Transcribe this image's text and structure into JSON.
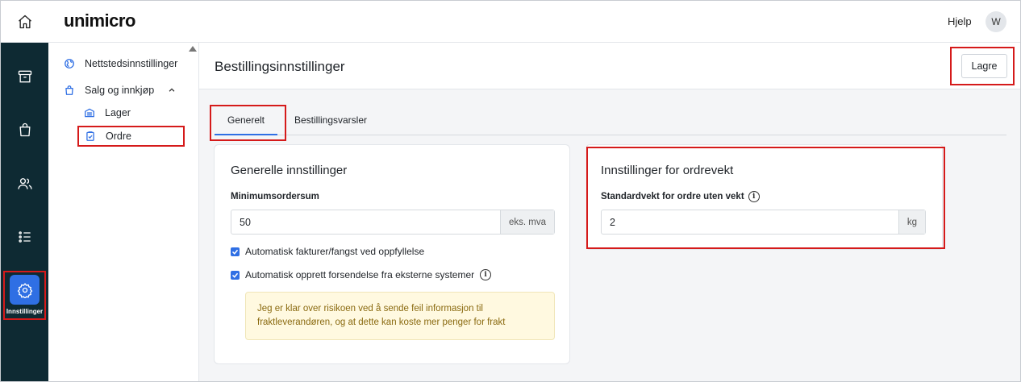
{
  "topbar": {
    "brand": "unimicro",
    "help_label": "Hjelp",
    "avatar_initial": "W"
  },
  "rail": {
    "items": [
      {
        "icon": "home-icon"
      },
      {
        "icon": "archive-icon"
      },
      {
        "icon": "shopping-bag-icon"
      },
      {
        "icon": "users-icon"
      },
      {
        "icon": "list-icon"
      },
      {
        "icon": "gear-icon",
        "label": "Innstillinger",
        "active": true
      }
    ]
  },
  "sidenav": {
    "items": [
      {
        "label": "Nettstedsinnstillinger",
        "icon": "globe-icon"
      },
      {
        "label": "Salg og innkjøp",
        "icon": "shopping-bag-icon",
        "expanded": true
      },
      {
        "label": "Lager",
        "icon": "warehouse-icon"
      },
      {
        "label": "Ordre",
        "icon": "clipboard-check-icon",
        "selected": true
      }
    ]
  },
  "page": {
    "title": "Bestillingsinnstillinger",
    "save_label": "Lagre"
  },
  "tabs": [
    {
      "label": "Generelt",
      "active": true
    },
    {
      "label": "Bestillingsvarsler",
      "active": false
    }
  ],
  "general": {
    "title": "Generelle innstillinger",
    "min_label": "Minimumsordersum",
    "min_value": "50",
    "min_suffix": "eks. mva",
    "check1_label": "Automatisk fakturer/fangst ved oppfyllelse",
    "check1_checked": true,
    "check2_label": "Automatisk opprett forsendelse fra eksterne systemer",
    "check2_checked": true,
    "warning_text": "Jeg er klar over risikoen ved å sende feil informasjon til fraktleverandøren, og at dette kan koste mer penger for frakt"
  },
  "weight": {
    "title": "Innstillinger for ordrevekt",
    "label": "Standardvekt for ordre uten vekt",
    "value": "2",
    "suffix": "kg"
  },
  "colors": {
    "rail_bg": "#0e2a33",
    "accent": "#2f6fe4",
    "highlight": "#d51a1a",
    "warning_bg": "#fff9e0"
  }
}
